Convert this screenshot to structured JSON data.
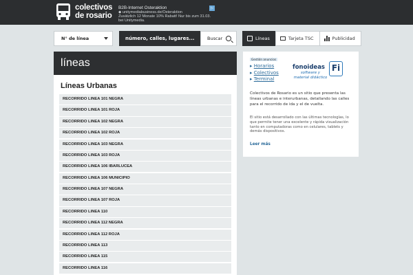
{
  "header": {
    "logo_line1": "colectivos",
    "logo_line2": "de rosario",
    "ad": {
      "title": "B2B-Internet Osteraktion",
      "line2": "◆ unitymediabusiness.de/Osteraktion",
      "line3": "Zusätzlich 12 Monate 10% Rabatt! Nur bis zum 31.03. bei Unitymedia."
    }
  },
  "nav": {
    "linea_select": "N° de línea",
    "search_placeholder": "número, calles, lugares...",
    "search_button": "Buscar",
    "tabs": [
      {
        "label": "Líneas",
        "icon": "lines-icon",
        "active": true
      },
      {
        "label": "Tarjeta TSC",
        "icon": "card-icon",
        "active": false
      },
      {
        "label": "Publicidad",
        "icon": "chart-icon",
        "active": false
      }
    ]
  },
  "main": {
    "title": "líneas",
    "subtitle": "Líneas Urbanas",
    "routes": [
      "RECORRIDO LINEA 101 NEGRA",
      "RECORRIDO LINEA 101 ROJA",
      "RECORRIDO LINEA 102 NEGRA",
      "RECORRIDO LINEA 102 ROJA",
      "RECORRIDO LINEA 103 NEGRA",
      "RECORRIDO LINEA 103 ROJA",
      "RECORRIDO LINEA 106 IBARLUCEA",
      "RECORRIDO LINEA 106 MUNICIPIO",
      "RECORRIDO LINEA 107 NEGRA",
      "RECORRIDO LINEA 107 ROJA",
      "RECORRIDO LINEA 110",
      "RECORRIDO LINEA 112 NEGRA",
      "RECORRIDO LINEA 112 ROJA",
      "RECORRIDO LINEA 113",
      "RECORRIDO LINEA 115",
      "RECORRIDO LINEA 116"
    ]
  },
  "sidebar": {
    "ad_label": "Gestión anuncios",
    "links": [
      "Horarios",
      "Colectivos",
      "Terminal"
    ],
    "ad_brand": "fonoideas",
    "ad_tagline": "software y material didáctico",
    "ad_mark": "Fi",
    "description1": "Colectivos de Rosario es un sitio que presenta las líneas urbanas e interurbanas, detallando las calles para el recorrido de ida y el de vuelta.",
    "description2": "El sitio está desarrollado con las últimas tecnologías, lo que permite tener una excelente y rápida visualización tanto en computadoras como en celulares, tablets y demás dispositivos.",
    "more_link": "Leer más"
  },
  "colors": {
    "header_bg": "#2c2e30",
    "page_bg": "#dfe4e6",
    "link": "#2a6a9a"
  }
}
